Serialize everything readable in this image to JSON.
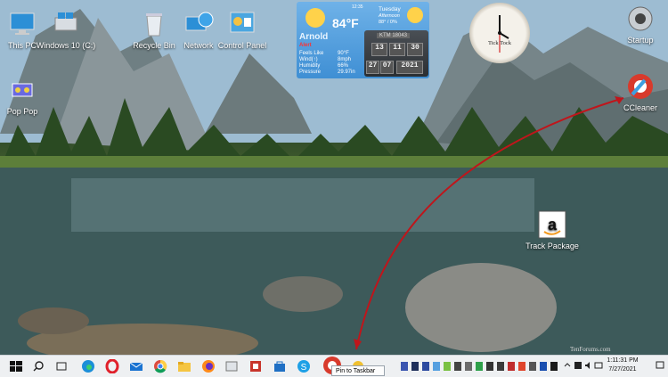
{
  "desktop": {
    "icons": [
      {
        "label": "This PC"
      },
      {
        "label": "Windows 10 (C:)"
      },
      {
        "label": "Recycle Bin"
      },
      {
        "label": "Network"
      },
      {
        "label": "Control Panel"
      },
      {
        "label": "Startup"
      },
      {
        "label": "Pop Pop"
      },
      {
        "label": "CCleaner"
      },
      {
        "label": "Track Package"
      }
    ]
  },
  "weather": {
    "temperature": "84°F",
    "city": "Arnold",
    "alert": "Alert",
    "time": "12:35",
    "day": "Tuesday",
    "period": "Afternoon",
    "temp_range": "88° / 0%",
    "rows": [
      {
        "label": "Feels Like",
        "value": "90°F"
      },
      {
        "label": "Wind(↑)",
        "value": "8mph"
      },
      {
        "label": "Humidity",
        "value": "66%"
      },
      {
        "label": "Pressure",
        "value": "29.97in"
      }
    ],
    "station": "KTM 18043",
    "digital_time": [
      "13",
      "11",
      "30"
    ],
    "digital_date": [
      "27",
      "07",
      "2021"
    ]
  },
  "analog_clock": {
    "brand": "Tick Tock"
  },
  "watermark": "TenForums.com",
  "tooltip": {
    "text": "Pin to Taskbar"
  },
  "taskbar": {
    "time": "1:11:31 PM",
    "date": "7/27/2021"
  }
}
